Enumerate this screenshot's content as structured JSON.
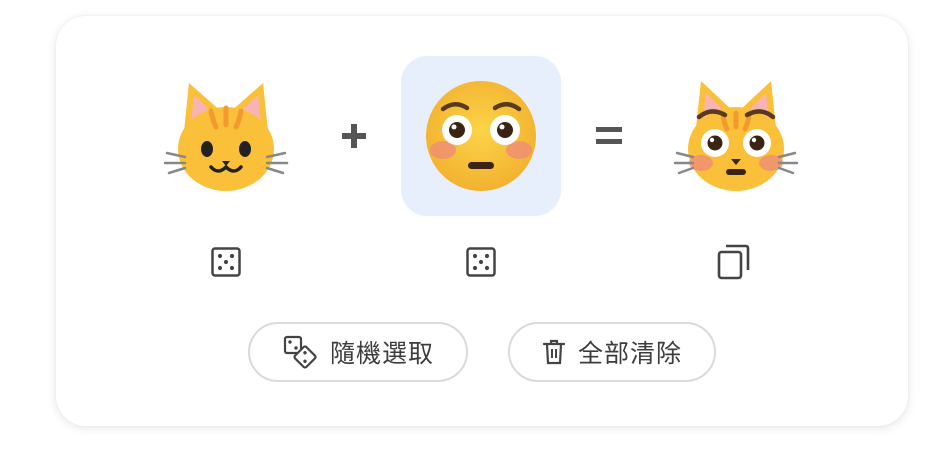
{
  "mixer": {
    "left_emoji": "cat-face-with-smile-emoji",
    "operator_plus": "+",
    "right_emoji": "flushed-face-emoji",
    "operator_equals": "=",
    "result_emoji": "flushed-cat-face-emoji"
  },
  "tools": {
    "left": "dice-icon",
    "right": "dice-icon",
    "result": "copy-icon"
  },
  "actions": {
    "random_label": "隨機選取",
    "clear_label": "全部清除"
  },
  "colors": {
    "selected_slot_bg": "#e8effc",
    "cat_fur": "#fbc03a",
    "cat_stripes": "#f29a2e",
    "face_yellow": "#f7c23a",
    "icon_gray": "#444444",
    "button_border": "#dadada"
  }
}
